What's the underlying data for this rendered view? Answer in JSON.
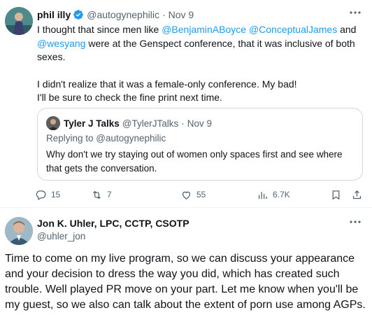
{
  "tweet1": {
    "display_name": "phil illy",
    "handle": "@autogynephilic",
    "separator": "·",
    "date": "Nov 9",
    "text_line1_a": "I thought that since men like ",
    "mention1": "@BenjaminABoyce",
    "mention2": "@ConceptualJames",
    "text_and": " and",
    "mention3": "@wesyang",
    "text_line2_b": " were at the Genspect conference, that it was inclusive of both sexes.",
    "paragraph2_line1": "I didn't realize that it was a female-only conference. My bad!",
    "paragraph2_line2": "I'll be sure to check the fine print next time.",
    "quote": {
      "display_name": "Tyler J Talks",
      "handle": "@TylerJTalks",
      "separator": "·",
      "date": "Nov 9",
      "replying_to": "Replying to @autogynephilic",
      "text": "Why don't we try staying out of women only spaces first and see where that gets the conversation."
    },
    "actions": {
      "replies": "15",
      "retweets": "7",
      "likes": "55",
      "views": "6.7K"
    },
    "icons": [
      "verified-badge-icon",
      "more-icon",
      "reply-icon",
      "retweet-icon",
      "like-icon",
      "views-icon",
      "bookmark-icon",
      "share-icon"
    ]
  },
  "tweet2": {
    "display_name": "Jon K. Uhler, LPC, CCTP, CSOTP",
    "handle": "@uhler_jon",
    "text": "Time to come on my live program, so we can discuss your appearance and your decision to dress the way you did, which has created such trouble. Well played PR move on your part. Let me know when you'll be my guest, so we also can talk about the extent of porn use among AGPs."
  },
  "colors": {
    "text": "#0f1419",
    "muted": "#536471",
    "link": "#1d9bf0",
    "border": "#cfd9de",
    "divider": "#eff3f4",
    "verified": "#1d9bf0"
  }
}
